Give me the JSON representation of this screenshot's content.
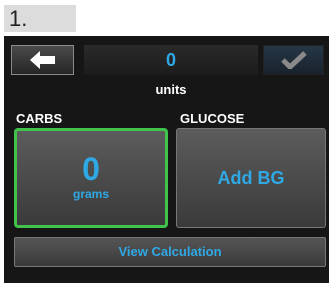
{
  "step": {
    "label": "1."
  },
  "header": {
    "back_icon": "left-arrow-icon",
    "units_value": "0",
    "confirm_icon": "checkmark-icon",
    "units_label": "units"
  },
  "carbs": {
    "label": "CARBS",
    "value": "0",
    "unit": "grams",
    "border_color": "#3fc34a"
  },
  "glucose": {
    "label": "GLUCOSE",
    "button_label": "Add BG"
  },
  "footer": {
    "view_calculation_label": "View Calculation"
  },
  "colors": {
    "accent": "#2fa9e6",
    "selected": "#3fc34a",
    "background": "#161616"
  }
}
